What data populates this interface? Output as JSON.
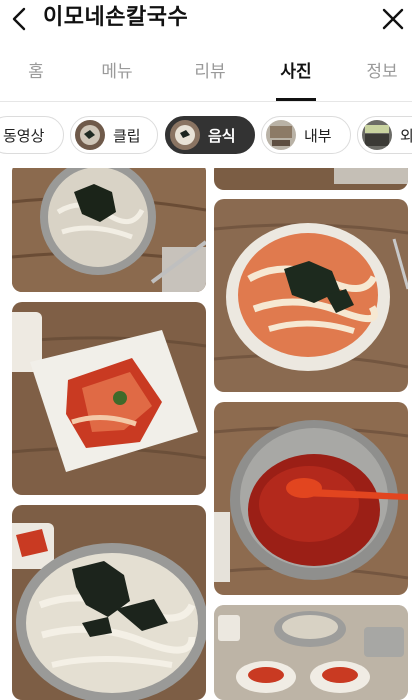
{
  "header": {
    "title": "이모네손칼국수",
    "back_icon": "chevron-left-icon",
    "close_icon": "close-icon"
  },
  "tabs": [
    {
      "label": "홈",
      "active": false
    },
    {
      "label": "메뉴",
      "active": false
    },
    {
      "label": "리뷰",
      "active": false
    },
    {
      "label": "사진",
      "active": true
    },
    {
      "label": "정보",
      "active": false
    }
  ],
  "filters": [
    {
      "label": "동영상",
      "active": false
    },
    {
      "label": "클립",
      "active": false
    },
    {
      "label": "음식",
      "active": true
    },
    {
      "label": "내부",
      "active": false
    },
    {
      "label": "외",
      "active": false
    }
  ],
  "photos": [
    {
      "name": "photo-kalguksu-top"
    },
    {
      "name": "photo-top-right-partial"
    },
    {
      "name": "photo-spicy-kalguksu"
    },
    {
      "name": "photo-kimchi-plate"
    },
    {
      "name": "photo-red-pepper-paste"
    },
    {
      "name": "photo-kalguksu-bowl"
    },
    {
      "name": "photo-table-set"
    }
  ],
  "colors": {
    "accent": "#333333",
    "tab_inactive": "#9a9a9a",
    "chip_border": "#dcdcdc"
  }
}
